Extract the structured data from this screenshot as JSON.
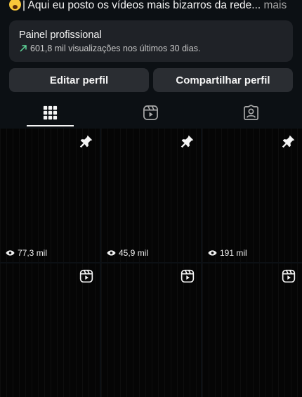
{
  "bio": {
    "text": "| Aqui eu posto os vídeos mais bizarros da rede...",
    "more": " mais"
  },
  "panel": {
    "title": "Painel profissional",
    "subtitle": "601,8 mil visualizações nos últimos 30 dias.",
    "accent": "#5fd89a"
  },
  "buttons": {
    "edit": "Editar perfil",
    "share": "Compartilhar perfil"
  },
  "tabs": [
    {
      "icon": "grid-icon",
      "active": true
    },
    {
      "icon": "reels-icon",
      "active": false
    },
    {
      "icon": "tagged-icon",
      "active": false
    }
  ],
  "posts": [
    {
      "views": "77,3 mil",
      "badge": "pin-icon"
    },
    {
      "views": "45,9 mil",
      "badge": "pin-icon"
    },
    {
      "views": "191 mil",
      "badge": "pin-icon"
    },
    {
      "views": "",
      "badge": "reel-icon"
    },
    {
      "views": "",
      "badge": "reel-icon"
    },
    {
      "views": "",
      "badge": "reel-icon"
    }
  ]
}
